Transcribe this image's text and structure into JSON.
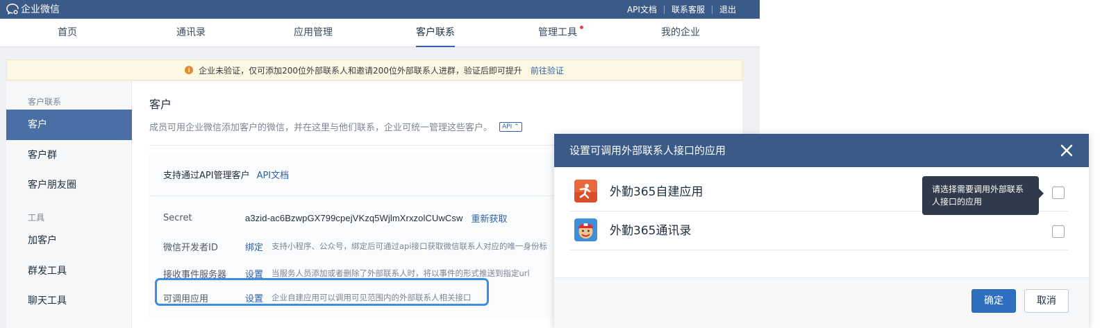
{
  "brand": {
    "name": "企业微信"
  },
  "top_links": [
    "API文档",
    "联系客服",
    "退出"
  ],
  "nav": {
    "items": [
      "首页",
      "通讯录",
      "应用管理",
      "客户联系",
      "管理工具",
      "我的企业"
    ],
    "active": "客户联系"
  },
  "notice": {
    "text": "企业未验证，仅可添加200位外部联系人和邀请200位外部联系人进群，验证后即可提升",
    "link": "前往验证",
    "color": "#e7892c"
  },
  "sidebar": {
    "group1": "客户联系",
    "items1": [
      "客户",
      "客户群",
      "客户朋友圈"
    ],
    "group2": "工具",
    "items2": [
      "加客户",
      "群发工具",
      "聊天工具"
    ]
  },
  "main": {
    "title": "客户",
    "description": "成员可用企业微信添加客户的微信，并在这里与他们联系，企业可统一管理这些客户。",
    "api_tag": "API",
    "panel_title": "支持通过API管理客户",
    "panel_link": "API文档",
    "rows": {
      "secret": {
        "label": "Secret",
        "value": "a3zid-ac6BzwpGX799cpejVKzq5WjlmXrxzolCUwCsw",
        "link": "重新获取"
      },
      "dev_id": {
        "label": "微信开发者ID",
        "link": "绑定",
        "desc": "支持小程序、公众号，绑定后可通过api接口获取微信联系人对应的唯一身份标"
      },
      "event_server": {
        "label": "接收事件服务器",
        "link": "设置",
        "desc": "当服务人员添加或者删除了外部联系人时，将以事件的形式推送到指定url"
      },
      "callable_apps": {
        "label": "可调用应用",
        "link": "设置",
        "desc": "企业自建应用可以调用可见范围内的外部联系人相关接口"
      }
    }
  },
  "modal": {
    "title": "设置可调用外部联系人接口的应用",
    "apps": [
      {
        "name": "外勤365自建应用",
        "icon": "waiqin-selfbuilt-app-icon",
        "checked": false
      },
      {
        "name": "外勤365通讯录",
        "icon": "waiqin-contacts-app-icon",
        "checked": false
      }
    ],
    "tooltip": "请选择需要调用外部联系人接口的应用",
    "confirm": "确定",
    "cancel": "取消"
  },
  "colors": {
    "header_blue": "#3a5a87",
    "accent_blue": "#2f62a8",
    "active_side": "#4a6fa5",
    "highlight_border": "#3d8de0",
    "red_dot": "#f04040"
  }
}
